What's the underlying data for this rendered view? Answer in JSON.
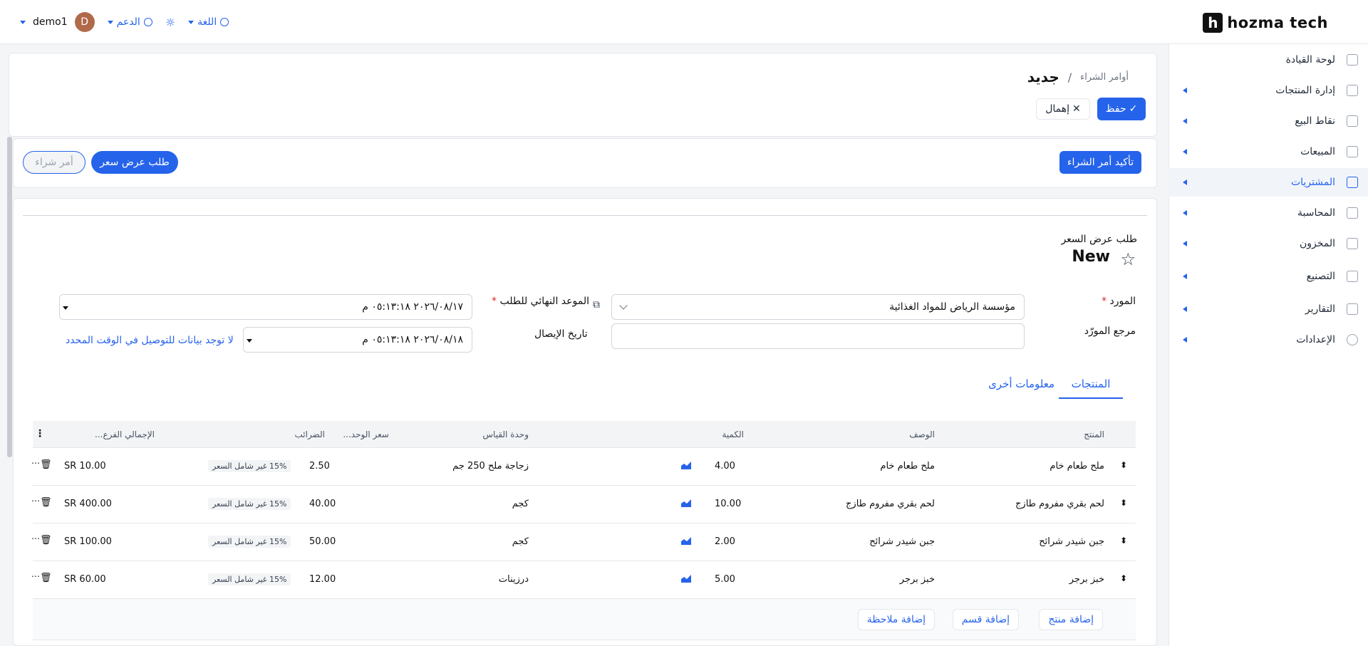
{
  "header": {
    "brand": "hozma tech",
    "brand_letter": "h",
    "user_name": "demo1",
    "avatar_letter": "D",
    "support_label": "الدعم",
    "language_label": "اللغة"
  },
  "sidebar": {
    "items": [
      {
        "label": "لوحة القيادة",
        "icon": "dashboard-icon"
      },
      {
        "label": "إدارة المنتجات",
        "icon": "tag-icon"
      },
      {
        "label": "نقاط البيع",
        "icon": "store-icon"
      },
      {
        "label": "المبيعات",
        "icon": "chart-icon"
      },
      {
        "label": "المشتريات",
        "icon": "purchase-icon"
      },
      {
        "label": "المحاسبة",
        "icon": "ledger-icon"
      },
      {
        "label": "المخزون",
        "icon": "box-icon"
      },
      {
        "label": "التصنيع",
        "icon": "factory-icon"
      },
      {
        "label": "التقارير",
        "icon": "report-icon"
      },
      {
        "label": "الإعدادات",
        "icon": "gear-icon"
      }
    ],
    "active": "المشتريات"
  },
  "breadcrumb": {
    "parent": "أوامر الشراء",
    "separator": "/",
    "current": "جديد"
  },
  "actions": {
    "save": "حفظ",
    "discard": "إهمال"
  },
  "status_bar": {
    "confirm": "تأكيد أمر الشراء",
    "rfq": "طلب عرض سعر",
    "po": "أمر شراء"
  },
  "document": {
    "type_label": "طلب عرض السعر",
    "name": "New"
  },
  "form": {
    "vendor_label": "المورد",
    "vendor_value": "مؤسسة الرياض للمواد الغذائية",
    "vendor_ref_label": "مرجع المورّد",
    "vendor_ref_value": "",
    "deadline_label": "الموعد النهائي للطلب",
    "deadline_value": "٢٠٢٦/٠٨/١٧ ٠٥:١٣:١٨ م",
    "receipt_label": "تاريخ الإيصال",
    "receipt_value": "٢٠٢٦/٠٨/١٨ ٠٥:١٣:١٨ م",
    "no_delivery": "لا توجد بيانات للتوصيل في الوقت المحدد",
    "required_mark": "*"
  },
  "tabs": {
    "products": "المنتجات",
    "other": "معلومات أخرى"
  },
  "table": {
    "headers": {
      "product": "المنتج",
      "description": "الوصف",
      "quantity": "الكمية",
      "uom": "وحدة القياس",
      "unit_price": "سعر الوحد...",
      "taxes": "الضرائب",
      "subtotal": "الإجمالي الفرع..."
    },
    "rows": [
      {
        "product": "ملح طعام خام",
        "description": "ملح طعام خام",
        "quantity": "4.00",
        "uom": "زجاجة ملح 250 جم",
        "unit_price": "2.50",
        "tax": "15% غير شامل السعر",
        "subtotal": "SR 10.00"
      },
      {
        "product": "لحم بقري مفروم طازج",
        "description": "لحم بقري مفروم طازج",
        "quantity": "10.00",
        "uom": "كجم",
        "unit_price": "40.00",
        "tax": "15% غير شامل السعر",
        "subtotal": "SR 400.00"
      },
      {
        "product": "جبن شيدر شرائح",
        "description": "جبن شيدر شرائح",
        "quantity": "2.00",
        "uom": "كجم",
        "unit_price": "50.00",
        "tax": "15% غير شامل السعر",
        "subtotal": "SR 100.00"
      },
      {
        "product": "خبز برجر",
        "description": "خبز برجر",
        "quantity": "5.00",
        "uom": "درزينات",
        "unit_price": "12.00",
        "tax": "15% غير شامل السعر",
        "subtotal": "SR 60.00"
      }
    ],
    "add_product": "إضافة منتج",
    "add_section": "إضافة قسم",
    "add_note": "إضافة ملاحظة"
  },
  "colors": {
    "accent": "#2563eb",
    "active_bg": "#f1f5f9"
  }
}
